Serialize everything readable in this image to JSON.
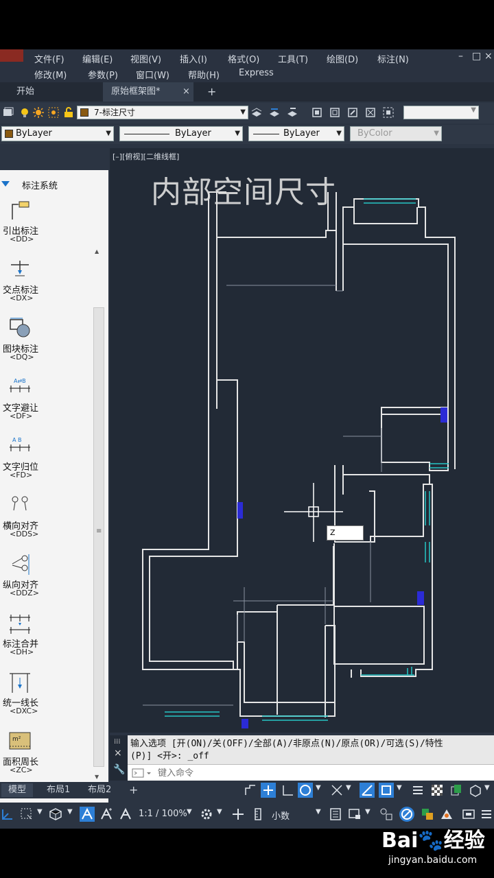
{
  "menu": {
    "row1": [
      "文件(F)",
      "编辑(E)",
      "视图(V)",
      "插入(I)",
      "格式(O)",
      "工具(T)",
      "绘图(D)",
      "标注(N)"
    ],
    "row2": [
      "修改(M)",
      "参数(P)",
      "窗口(W)",
      "帮助(H)",
      "Express"
    ],
    "window_controls": [
      "–",
      "□",
      "×"
    ]
  },
  "tabs": {
    "start": "开始",
    "drawing": "原始框架图*",
    "close": "×",
    "add": "+"
  },
  "layer": {
    "current": "7-标注尺寸",
    "swatch_color": "#8a5a12"
  },
  "properties": {
    "color": "ByLayer",
    "linetype": "ByLayer",
    "lineweight": "ByLayer",
    "plotstyle": "ByColor"
  },
  "panel": {
    "title": "标注系统",
    "items": [
      {
        "name": "引出标注",
        "code": "<DD>",
        "icon": "leader-dimension-icon"
      },
      {
        "name": "交点标注",
        "code": "<DX>",
        "icon": "intersection-dimension-icon"
      },
      {
        "name": "图块标注",
        "code": "<DQ>",
        "icon": "block-dimension-icon"
      },
      {
        "name": "文字避让",
        "code": "<DF>",
        "icon": "text-avoid-icon"
      },
      {
        "name": "文字归位",
        "code": "<FD>",
        "icon": "text-reset-icon"
      },
      {
        "name": "横向对齐",
        "code": "<DDS>",
        "icon": "horizontal-align-icon"
      },
      {
        "name": "纵向对齐",
        "code": "<DDZ>",
        "icon": "vertical-align-icon"
      },
      {
        "name": "标注合并",
        "code": "<DH>",
        "icon": "merge-dimension-icon"
      },
      {
        "name": "统一线长",
        "code": "<DXC>",
        "icon": "unify-line-length-icon"
      },
      {
        "name": "面积周长",
        "code": "<ZC>",
        "icon": "area-perimeter-icon"
      }
    ]
  },
  "viewport": {
    "label": "[–][俯视][二维线框]",
    "title_text": "内部空间尺寸",
    "coord_input": "Z"
  },
  "command": {
    "line1": "输入选项 [开(ON)/关(OFF)/全部(A)/非原点(N)/原点(OR)/可选(S)/特性",
    "line2": "(P)] <开>: _off",
    "placeholder": "键入命令"
  },
  "layouts": {
    "model": "模型",
    "layout1": "布局1",
    "layout2": "布局2",
    "add": "+"
  },
  "status": {
    "scale": "1:1 / 100%",
    "units": "小数"
  },
  "watermark": {
    "logo": "Bai🐾经验",
    "url": "jingyan.baidu.com"
  },
  "colors": {
    "wall": "#e6e6e6",
    "window": "#26c6c6",
    "accent": "#2d7fd6",
    "grip": "#2b2bd6"
  }
}
